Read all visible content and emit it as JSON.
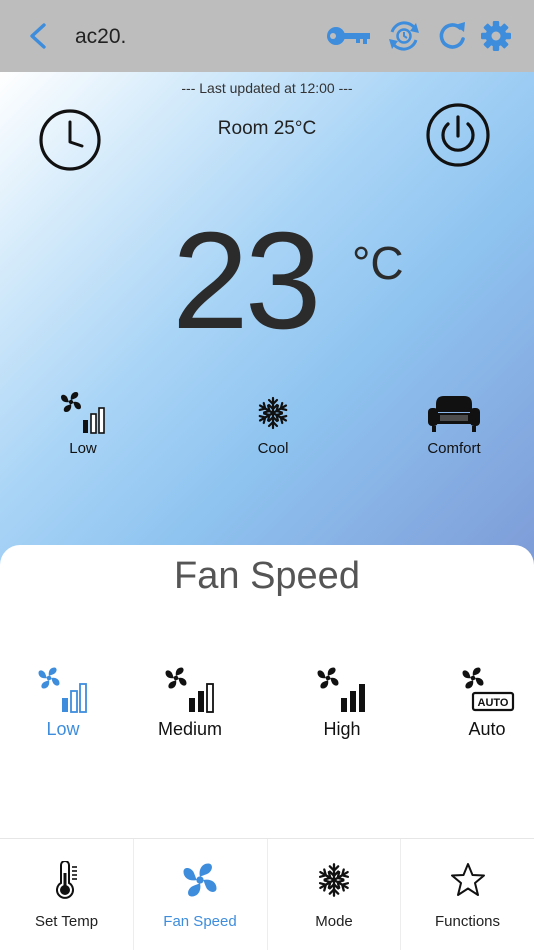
{
  "header": {
    "title": "ac20.",
    "icons": [
      "back-chevron-icon",
      "key-icon",
      "sync-icon",
      "refresh-icon",
      "gear-icon"
    ],
    "accent_color": "#3e8ddd",
    "background_color": "#bdbdbd"
  },
  "status": {
    "last_updated": "--- Last updated at 12:00 ---",
    "room": "Room 25°C",
    "set_temperature": "23",
    "unit": "°C",
    "fan_label": "Low",
    "mode_label": "Cool",
    "preset_label": "Comfort"
  },
  "fan_speed_panel": {
    "title": "Fan Speed",
    "options": [
      {
        "label": "Low",
        "selected": true
      },
      {
        "label": "Medium",
        "selected": false
      },
      {
        "label": "High",
        "selected": false
      },
      {
        "label": "Auto",
        "selected": false
      }
    ],
    "auto_badge": "AUTO"
  },
  "bottom_nav": {
    "tabs": [
      {
        "label": "Set Temp",
        "icon": "thermometer-icon",
        "active": false
      },
      {
        "label": "Fan Speed",
        "icon": "fan-icon",
        "active": true
      },
      {
        "label": "Mode",
        "icon": "snowflake-icon",
        "active": false
      },
      {
        "label": "Functions",
        "icon": "star-icon",
        "active": false
      }
    ]
  }
}
